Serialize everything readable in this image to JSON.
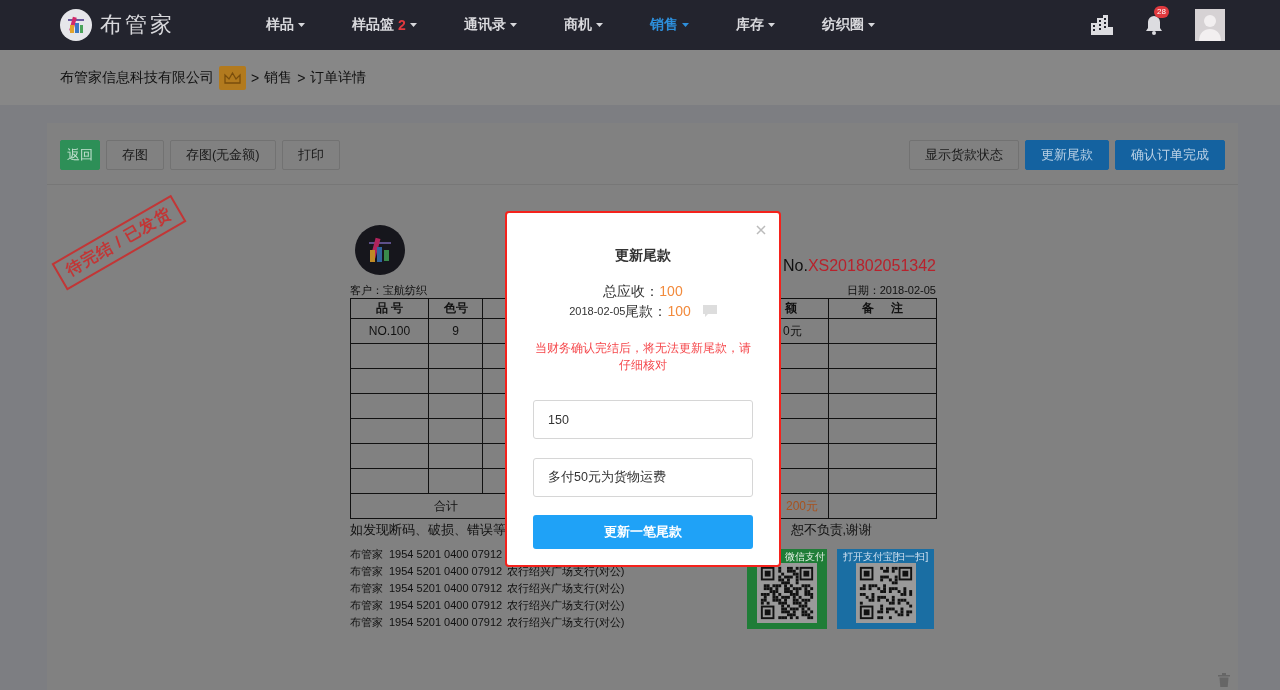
{
  "header": {
    "brand": "布管家",
    "nav": [
      {
        "label": "样品",
        "selected": false
      },
      {
        "label": "样品篮",
        "count": "2",
        "selected": false
      },
      {
        "label": "通讯录",
        "selected": false
      },
      {
        "label": "商机",
        "selected": false
      },
      {
        "label": "销售",
        "selected": true
      },
      {
        "label": "库存",
        "selected": false
      },
      {
        "label": "纺织圈",
        "selected": false
      }
    ],
    "notifications": "28"
  },
  "breadcrumb": {
    "company": "布管家信息科技有限公司",
    "separator": ">",
    "items": [
      "销售",
      "订单详情"
    ]
  },
  "toolbar": {
    "left": [
      {
        "label": "返回",
        "kind": "success"
      },
      {
        "label": "存图",
        "kind": "default"
      },
      {
        "label": "存图(无金额)",
        "kind": "default"
      },
      {
        "label": "打印",
        "kind": "default"
      }
    ],
    "right": [
      {
        "label": "显示货款状态",
        "kind": "default"
      },
      {
        "label": "更新尾款",
        "kind": "primary"
      },
      {
        "label": "确认订单完成",
        "kind": "primary"
      }
    ]
  },
  "stamp": "待完结 / 已发货",
  "order": {
    "no_prefix": "No.",
    "number": "XS201802051342",
    "customer": "客户：宝航纺织",
    "date": "日期：2018-02-05",
    "table": {
      "columns": {
        "item_no": "品 号",
        "color_no": "色号",
        "column_6": "额",
        "remarks": "备 注"
      },
      "rows": [
        {
          "item_no": "NO.100",
          "color_no": "9",
          "column_6": "0元"
        }
      ],
      "total": {
        "label": "合计",
        "amount": "200元"
      }
    },
    "notice": {
      "left": "如发现断码、破损、错误等",
      "right": "恕不负责,谢谢"
    },
    "bank_accounts": [
      {
        "name": "布管家",
        "number": "1954 5201 0400 07912"
      },
      {
        "name": "布管家",
        "number": "1954 5201 0400 07912",
        "bank": "农行绍兴广场支行(对公)"
      },
      {
        "name": "布管家",
        "number": "1954 5201 0400 07912",
        "bank": "农行绍兴广场支行(对公)"
      },
      {
        "name": "布管家",
        "number": "1954 5201 0400 07912",
        "bank": "农行绍兴广场支行(对公)"
      },
      {
        "name": "布管家",
        "number": "1954 5201 0400 07912",
        "bank": "农行绍兴广场支行(对公)"
      }
    ],
    "qr_codes": [
      {
        "caption": "微信支付",
        "color": "#1f7d37"
      },
      {
        "caption": "打开支付宝[扫一扫]",
        "color": "#1a6ea3"
      }
    ]
  },
  "modal": {
    "title": "更新尾款",
    "total": {
      "label": "总应收：",
      "amount": "100"
    },
    "balance": {
      "date": "2018-02-05",
      "label": "尾款：",
      "amount": "100"
    },
    "warning": "当财务确认完结后，将无法更新尾款，请仔细核对",
    "amount_input": {
      "value": "150"
    },
    "note_input": {
      "value": "多付50元为货物运费"
    },
    "submit": "更新一笔尾款"
  }
}
